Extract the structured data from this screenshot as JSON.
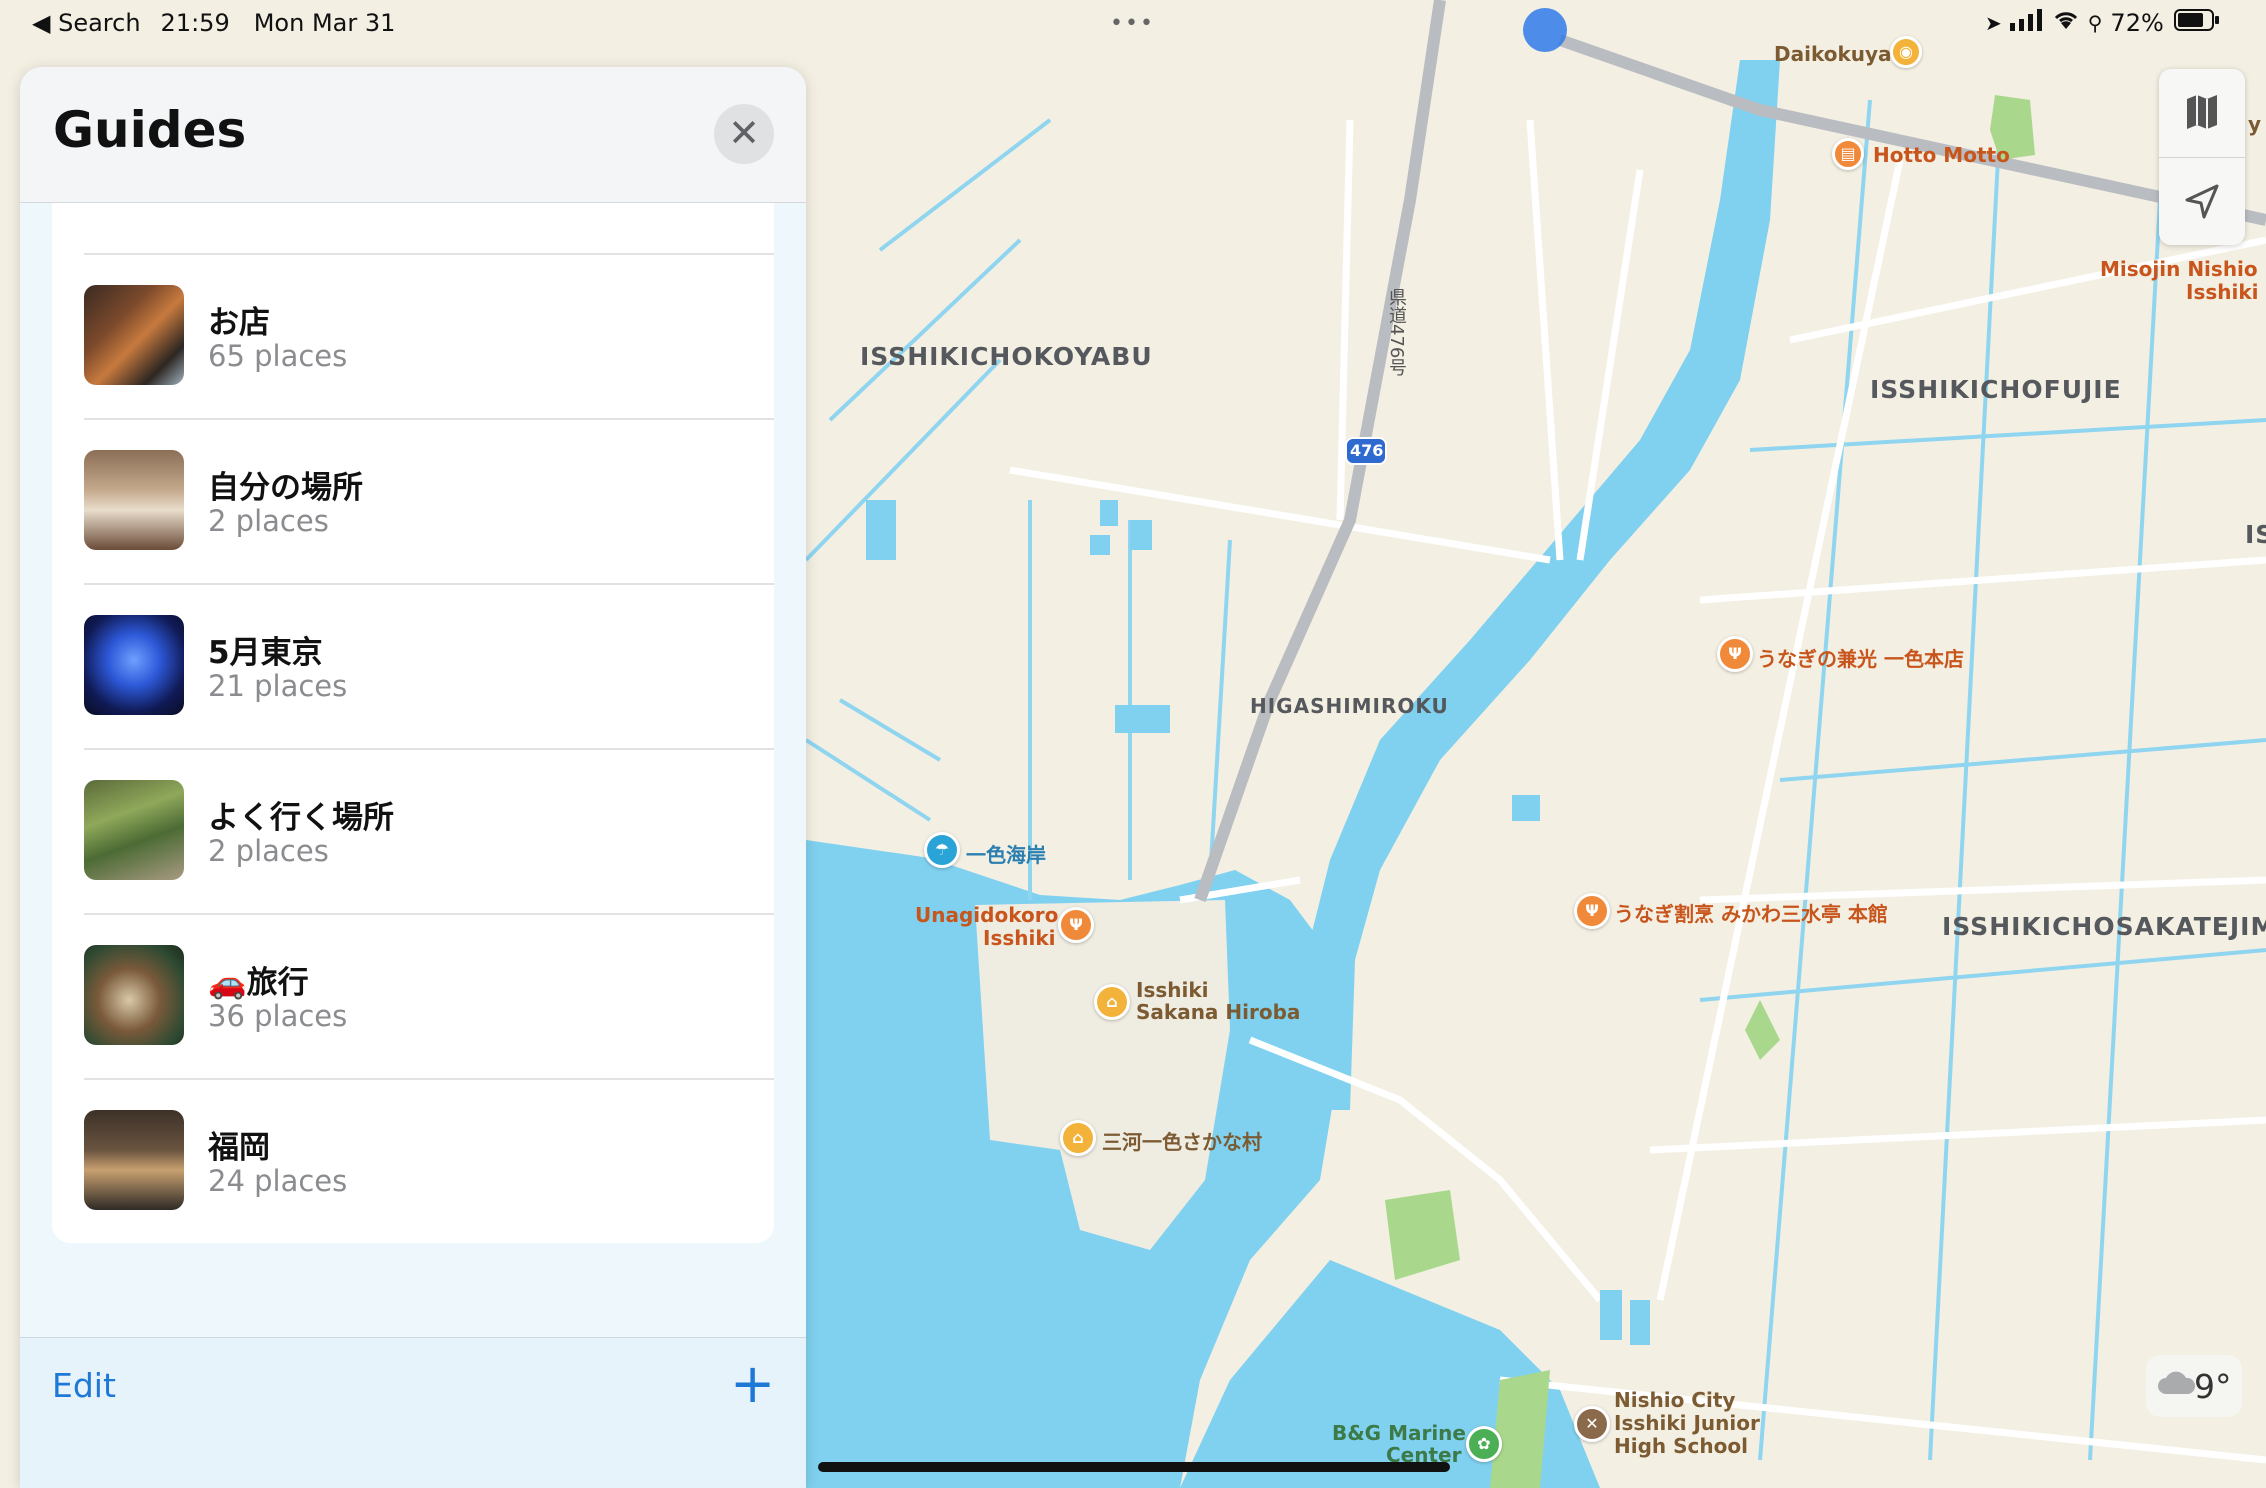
{
  "status_bar": {
    "back_label": "◀ Search",
    "time": "21:59",
    "date": "Mon Mar 31",
    "more_dots": "•••",
    "battery_percent": "72%"
  },
  "guides": {
    "title": "Guides",
    "close_icon": "close-icon",
    "items": [
      {
        "title": "お店",
        "subtitle": "65 places"
      },
      {
        "title": "自分の場所",
        "subtitle": "2 places"
      },
      {
        "title": "5月東京",
        "subtitle": "21 places"
      },
      {
        "title": "よく行く場所",
        "subtitle": "2 places"
      },
      {
        "title": "🚗旅行",
        "subtitle": "36 places"
      },
      {
        "title": "福岡",
        "subtitle": "24 places"
      }
    ],
    "edit_label": "Edit",
    "add_label": "+"
  },
  "map": {
    "districts": [
      "ISSHIKICHOKOYABU",
      "ISSHIKICHOFUJIE",
      "HIGASHIMIROKU",
      "ISSHIKICHOSAKATEJIMA",
      "IS"
    ],
    "pois": {
      "daikokuya": "Daikokuya",
      "hotto_motto": "Hotto Motto",
      "misojin_1": "Misojin Nishio",
      "misojin_2": "Isshiki",
      "unagi_kanemitsu": "うなぎの兼光 一色本店",
      "unagi_mikawa": "うなぎ割烹 みかわ三水亭 本館",
      "isshiki_beach": "一色海岸",
      "unagidokoro_1": "Unagidokoro",
      "unagidokoro_2": "Isshiki",
      "sakana_hiroba_1": "Isshiki",
      "sakana_hiroba_2": "Sakana Hiroba",
      "mikawa_sakana": "三河一色さかな村",
      "bg_marine_1": "B&G Marine",
      "bg_marine_2": "Center",
      "school_1": "Nishio City",
      "school_2": "Isshiki Junior",
      "school_3": "High School",
      "route_label": "県道476号",
      "route_shield": "476",
      "edge_y": "y"
    },
    "weather_temp": "9°",
    "colors": {
      "water": "#7fd1ef",
      "land": "#f3efe3",
      "park": "#a9d88c",
      "accent": "#1e78d6"
    }
  }
}
